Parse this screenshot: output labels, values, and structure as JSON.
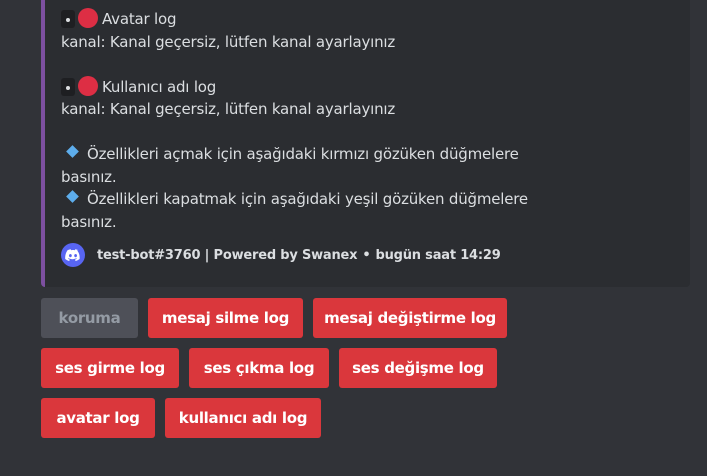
{
  "embed": {
    "accent_color": "#7d50a0",
    "lines": {
      "avatar_title": "Avatar log",
      "avatar_channel": "kanal: Kanal geçersiz, lütfen kanal ayarlayınız",
      "username_title": "Kullanıcı adı log",
      "username_channel": "kanal: Kanal geçersiz, lütfen kanal ayarlayınız",
      "info_open": "Özellikleri açmak için aşağıdaki kırmızı gözüken düğmelere basınız.",
      "info_close": "Özellikleri kapatmak için aşağıdaki yeşil gözüken düğmelere basınız."
    },
    "icons": {
      "status_dot": "red-circle-icon",
      "info_marker": "blue-diamond-icon"
    },
    "footer": {
      "bot_tag": "test-bot#3760 | Powered by Swanex",
      "separator": "•",
      "timestamp": "bugün saat 14:29",
      "icon": "discord-icon"
    }
  },
  "buttons": {
    "koruma": "koruma",
    "mesaj_silme": "mesaj silme log",
    "mesaj_degistirme": "mesaj değiştirme log",
    "ses_girme": "ses girme log",
    "ses_cikma": "ses çıkma log",
    "ses_degisme": "ses değişme log",
    "avatar": "avatar log",
    "kullanici_adi": "kullanıcı adı log"
  },
  "colors": {
    "background": "#313338",
    "embed_background": "#2b2d31",
    "danger_button": "#da373c",
    "disabled_button": "#4e5058",
    "blurple": "#5865f2"
  }
}
